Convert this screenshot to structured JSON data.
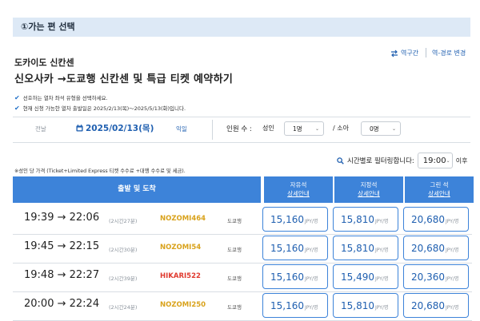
{
  "section_title": "①가는 편 선택",
  "actions": {
    "reverse": "역구간",
    "route_change": "역-경로 변경"
  },
  "line_name": "도카이도 신칸센",
  "title": "신오사카 →도쿄행 신칸센 및 특급 티켓 예약하기",
  "notes": [
    "선호하는 열차 좌석 유형을 선택하세요.",
    "현재 신청 가능한 열차 출발일은 2025/2/13(목)～2025/5/13(화)입니다."
  ],
  "date_nav": {
    "prev": "전날",
    "current": "2025/02/13(목)",
    "next": "익일"
  },
  "passengers": {
    "label": "인원 수 :",
    "adult_label": "성인",
    "adult_value": "1명",
    "child_label": "/ 소아",
    "child_value": "0명"
  },
  "filter": {
    "label": "시간별로 필터링합니다:",
    "time": "19:00",
    "suffix": "이후"
  },
  "fare_note": "※성인 당 가격 (Ticket+Limited Express 티켓 수수료 +대행 수수료 및 세금).",
  "table": {
    "header_main": "출발 및 도착",
    "seat_types": [
      {
        "name": "자유석",
        "link": "상세안내"
      },
      {
        "name": "지정석",
        "link": "상세안내"
      },
      {
        "name": "그린 석",
        "link": "상세안내"
      }
    ],
    "fare_unit": "JPY/명",
    "rows": [
      {
        "time": "19:39 → 22:06",
        "duration": "(2시간27분)",
        "train": "NOZOMI464",
        "train_color": "#d9a21b",
        "dest": "도쿄행",
        "fares": [
          "15,160",
          "15,810",
          "20,680"
        ]
      },
      {
        "time": "19:45 → 22:15",
        "duration": "(2시간30분)",
        "train": "NOZOMI54",
        "train_color": "#d9a21b",
        "dest": "도쿄행",
        "fares": [
          "15,160",
          "15,810",
          "20,680"
        ]
      },
      {
        "time": "19:48 → 22:27",
        "duration": "(2시간39분)",
        "train": "HIKARI522",
        "train_color": "#e03a2f",
        "dest": "도쿄행",
        "fares": [
          "15,160",
          "15,490",
          "20,360"
        ]
      },
      {
        "time": "20:00 → 22:24",
        "duration": "(2시간24분)",
        "train": "NOZOMI250",
        "train_color": "#d9a21b",
        "dest": "도쿄행",
        "fares": [
          "15,160",
          "15,810",
          "20,680"
        ]
      }
    ]
  }
}
